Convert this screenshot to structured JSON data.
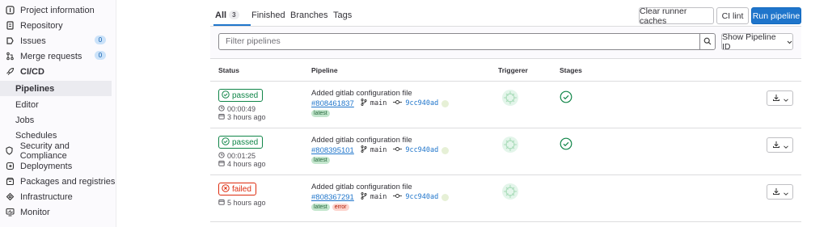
{
  "sidebar": {
    "items": [
      {
        "label": "Project information",
        "icon": "info-icon"
      },
      {
        "label": "Repository",
        "icon": "doc-icon"
      },
      {
        "label": "Issues",
        "icon": "issues-icon",
        "count": "0"
      },
      {
        "label": "Merge requests",
        "icon": "merge-icon",
        "count": "0"
      },
      {
        "label": "CI/CD",
        "icon": "rocket-icon"
      },
      {
        "label": "Pipelines"
      },
      {
        "label": "Editor"
      },
      {
        "label": "Jobs"
      },
      {
        "label": "Schedules"
      },
      {
        "label": "Security and Compliance",
        "icon": "shield-icon"
      },
      {
        "label": "Deployments",
        "icon": "deploy-icon"
      },
      {
        "label": "Packages and registries",
        "icon": "package-icon"
      },
      {
        "label": "Infrastructure",
        "icon": "cloud-icon"
      },
      {
        "label": "Monitor",
        "icon": "monitor-icon"
      }
    ]
  },
  "tabs": {
    "all_label": "All",
    "all_count": "3",
    "finished_label": "Finished",
    "branches_label": "Branches",
    "tags_label": "Tags"
  },
  "actions": {
    "clear_cache": "Clear runner caches",
    "ci_lint": "CI lint",
    "run_pipeline": "Run pipeline"
  },
  "filter": {
    "placeholder": "Filter pipelines",
    "show_id": "Show Pipeline ID"
  },
  "table": {
    "headers": {
      "status": "Status",
      "pipeline": "Pipeline",
      "triggerer": "Triggerer",
      "stages": "Stages"
    },
    "rows": [
      {
        "status": "passed",
        "duration": "00:00:49",
        "finished": "3 hours ago",
        "title": "Added gitlab configuration file",
        "id": "#808461837",
        "branch": "main",
        "commit": "9cc940ad",
        "badges": [
          "latest"
        ],
        "stage_status": "passed"
      },
      {
        "status": "passed",
        "duration": "00:01:25",
        "finished": "4 hours ago",
        "title": "Added gitlab configuration file",
        "id": "#808395101",
        "branch": "main",
        "commit": "9cc940ad",
        "badges": [
          "latest"
        ],
        "stage_status": "passed"
      },
      {
        "status": "failed",
        "finished": "5 hours ago",
        "title": "Added gitlab configuration file",
        "id": "#808367291",
        "branch": "main",
        "commit": "9cc940ad",
        "badges": [
          "latest",
          "error"
        ]
      }
    ]
  },
  "colors": {
    "accent": "#1f75cb",
    "success": "#108548",
    "danger": "#dd2b0e"
  }
}
